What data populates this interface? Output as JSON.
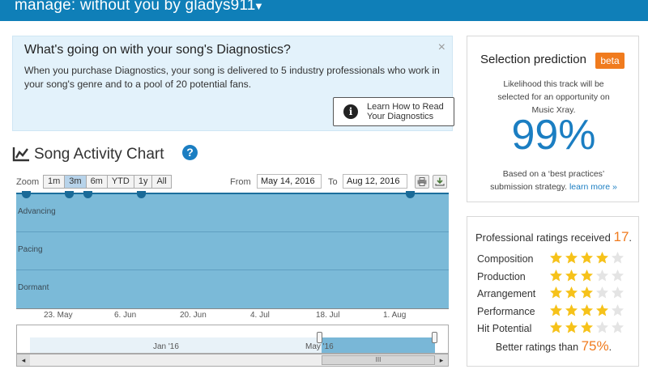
{
  "header": {
    "title": "manage: without you by gladys911",
    "caret": "▼"
  },
  "diagnostics": {
    "heading": "What's going on with your song's Diagnostics?",
    "close": "×",
    "body": "When you purchase Diagnostics, your song is delivered to 5 industry professionals who work in your song's genre and to a pool of 20 potential fans.",
    "learn_icon": "i",
    "learn_label": "Learn How to Read Your Diagnostics"
  },
  "chart": {
    "title": "Song Activity Chart",
    "help": "?",
    "zoom_label": "Zoom",
    "zoom_options": [
      "1m",
      "3m",
      "6m",
      "YTD",
      "1y",
      "All"
    ],
    "zoom_selected": "3m",
    "from_label": "From",
    "from_value": "May 14, 2016",
    "to_label": "To",
    "to_value": "Aug 12, 2016",
    "print_icon": "print-icon",
    "download_icon": "download-icon",
    "bands": [
      "Advancing",
      "Pacing",
      "Dormant"
    ],
    "x_ticks": [
      "23. May",
      "6. Jun",
      "20. Jun",
      "4. Jul",
      "18. Jul",
      "1. Aug"
    ],
    "navigator_labels": [
      "Jan '16",
      "May '16"
    ],
    "scroll_left": "◂",
    "scroll_right": "▸",
    "scroll_thumb": "III"
  },
  "selection": {
    "title": "Selection prediction",
    "badge": "beta",
    "likelihood": "Likelihood this track will be selected for an opportunity on Music Xray.",
    "percent": "99%",
    "based_on": "Based on a ‘best practices’ submission strategy.",
    "learn_more": "learn more »"
  },
  "ratings": {
    "received_label": "Professional ratings received",
    "received_count": "17",
    "received_suffix": ".",
    "items": [
      {
        "label": "Composition",
        "stars": 4
      },
      {
        "label": "Production",
        "stars": 3
      },
      {
        "label": "Arrangement",
        "stars": 3
      },
      {
        "label": "Performance",
        "stars": 4
      },
      {
        "label": "Hit Potential",
        "stars": 3
      }
    ],
    "max_stars": 5,
    "better_label": "Better ratings than",
    "better_value": "75%",
    "better_suffix": ".",
    "star_color": "#f6c21a",
    "empty_star_color": "#e4e4e4"
  }
}
